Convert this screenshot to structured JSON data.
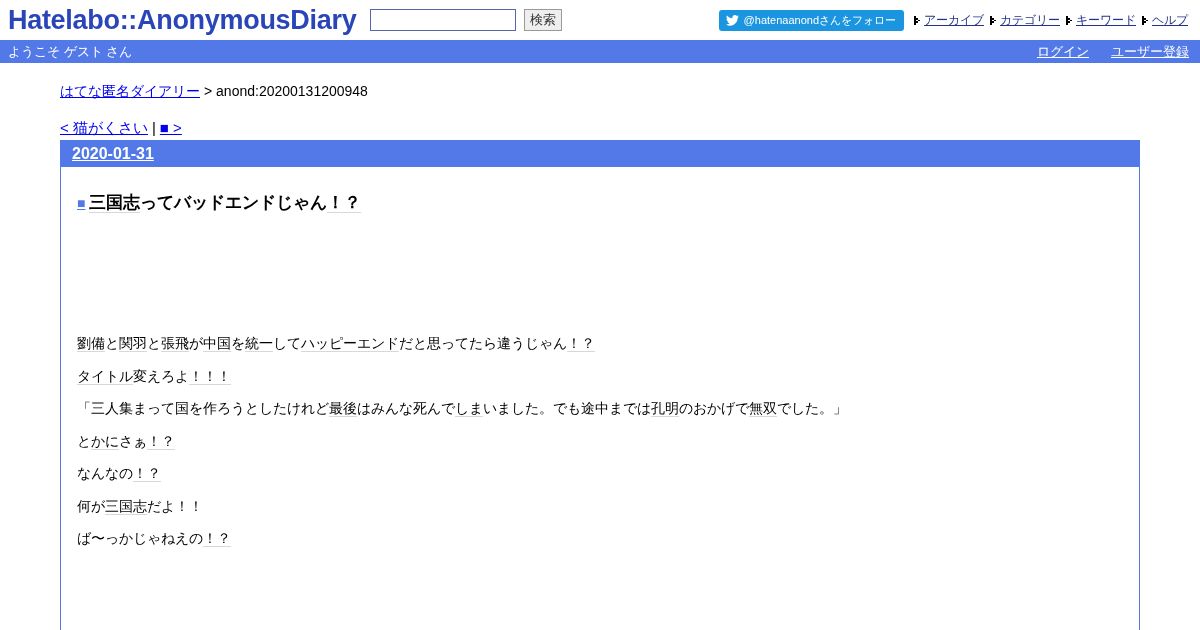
{
  "header": {
    "logo": "Hatelabo::AnonymousDiary",
    "search": {
      "button": "検索"
    },
    "follow_button": "@hatenaanondさんをフォロー",
    "nav": [
      "アーカイブ",
      "カテゴリー",
      "キーワード",
      "ヘルプ"
    ]
  },
  "user_bar": {
    "welcome": "ようこそ ゲスト さん",
    "links": [
      "ログイン",
      "ユーザー登録"
    ]
  },
  "breadcrumb": {
    "link": "はてな匿名ダイアリー",
    "current": "> anond:20200131200948"
  },
  "pager": {
    "prev": "< 猫がくさい",
    "separator": "|",
    "next": "■ >"
  },
  "day": {
    "date": "2020-01-31",
    "title": {
      "mark": "■",
      "segments": [
        {
          "text": "三国志",
          "keyword": true
        },
        {
          "text": "ってバッドエンドじゃん",
          "keyword": false
        },
        {
          "text": "！？",
          "keyword": true
        }
      ]
    },
    "paragraphs": [
      [
        {
          "text": "劉備",
          "keyword": true
        },
        {
          "text": "と",
          "keyword": false
        },
        {
          "text": "関羽",
          "keyword": true
        },
        {
          "text": "と",
          "keyword": false
        },
        {
          "text": "張飛",
          "keyword": true
        },
        {
          "text": "が",
          "keyword": false
        },
        {
          "text": "中国",
          "keyword": true
        },
        {
          "text": "を",
          "keyword": false
        },
        {
          "text": "統一",
          "keyword": true
        },
        {
          "text": "して",
          "keyword": false
        },
        {
          "text": "ハッピーエンド",
          "keyword": true
        },
        {
          "text": "だと思ってたら違うじゃん",
          "keyword": false
        },
        {
          "text": "！？",
          "keyword": true
        }
      ],
      [
        {
          "text": "タイトル",
          "keyword": true
        },
        {
          "text": "変えろよ",
          "keyword": false
        },
        {
          "text": "！！！",
          "keyword": true
        }
      ],
      [
        {
          "text": "「三人集まって国を作ろうとしたけれど",
          "keyword": false
        },
        {
          "text": "最後",
          "keyword": true
        },
        {
          "text": "はみんな死んで",
          "keyword": false
        },
        {
          "text": "しま",
          "keyword": true
        },
        {
          "text": "いました。でも途中までは",
          "keyword": false
        },
        {
          "text": "孔明",
          "keyword": true
        },
        {
          "text": "のおかげで",
          "keyword": false
        },
        {
          "text": "無双",
          "keyword": true
        },
        {
          "text": "でした。」",
          "keyword": false
        }
      ],
      [
        {
          "text": "と",
          "keyword": false
        },
        {
          "text": "かに",
          "keyword": true
        },
        {
          "text": "さぁ",
          "keyword": false
        },
        {
          "text": "！？",
          "keyword": true
        }
      ],
      [
        {
          "text": "なんなの",
          "keyword": false
        },
        {
          "text": "！？",
          "keyword": true
        }
      ],
      [
        {
          "text": "何が",
          "keyword": false
        },
        {
          "text": "三国志",
          "keyword": true
        },
        {
          "text": "だよ！！",
          "keyword": false
        }
      ],
      [
        {
          "text": "ば〜っかじゃねえの",
          "keyword": false
        },
        {
          "text": "！？",
          "keyword": true
        }
      ]
    ]
  }
}
